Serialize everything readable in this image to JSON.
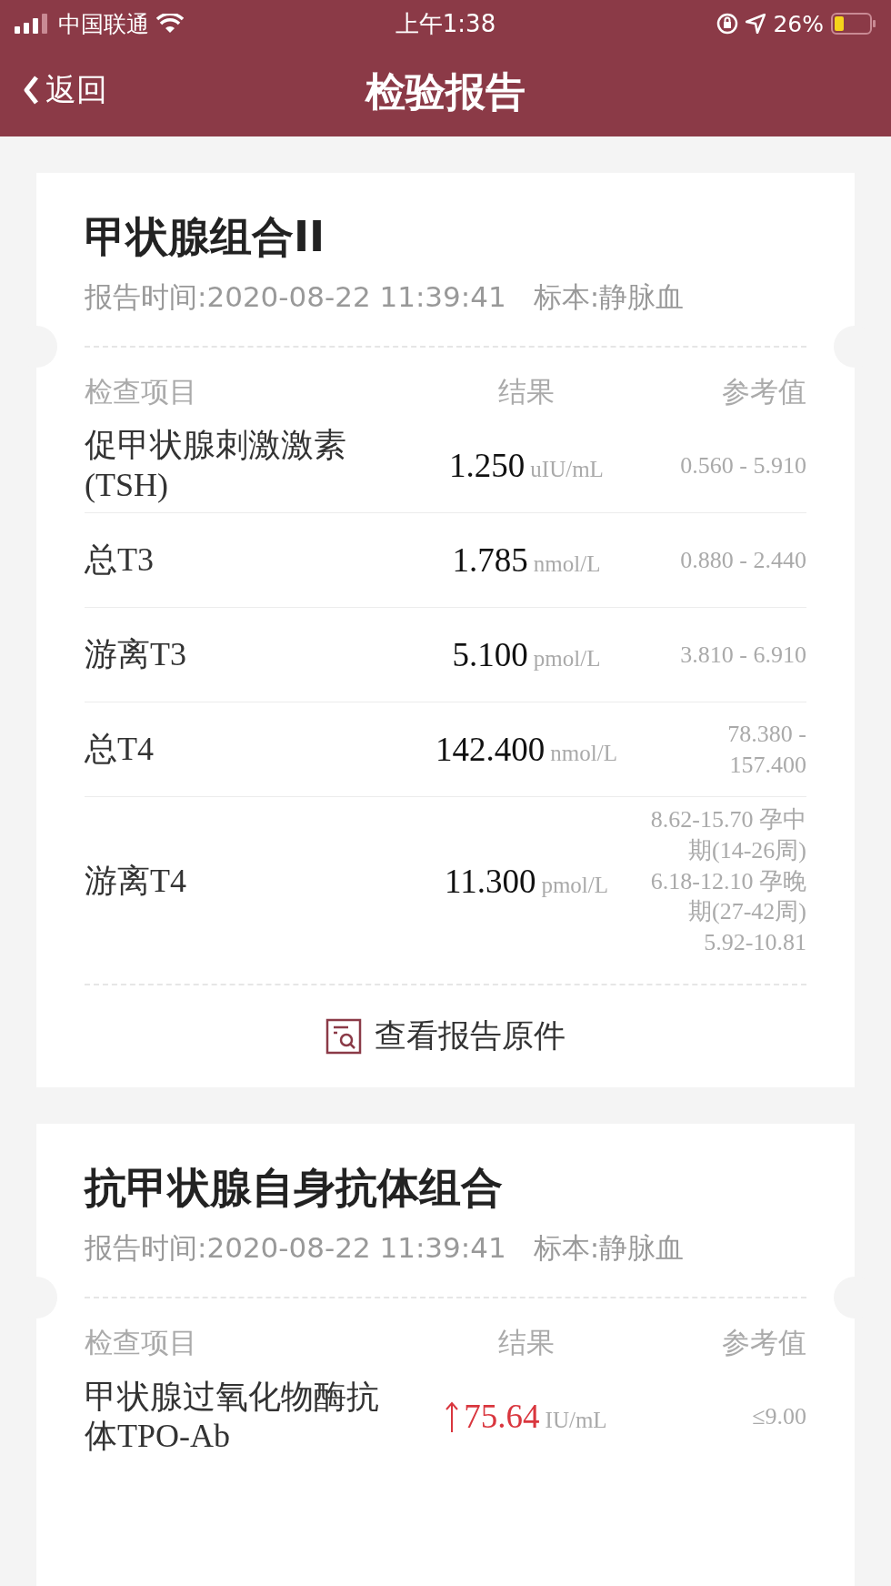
{
  "status_bar": {
    "carrier": "中国联通",
    "time": "上午1:38",
    "battery": "26%"
  },
  "nav": {
    "back": "返回",
    "title": "检验报告"
  },
  "reports": [
    {
      "title": "甲状腺组合II",
      "report_time": "报告时间:2020-08-22 11:39:41",
      "specimen": "标本:静脉血",
      "columns": [
        "检查项目",
        "结果",
        "参考值"
      ],
      "items": [
        {
          "name": "促甲状腺刺激激素(TSH)",
          "value": "1.250",
          "unit": "uIU/mL",
          "reference": "0.560 - 5.910",
          "high": false
        },
        {
          "name": "总T3",
          "value": "1.785",
          "unit": "nmol/L",
          "reference": "0.880 - 2.440",
          "high": false
        },
        {
          "name": "游离T3",
          "value": "5.100",
          "unit": "pmol/L",
          "reference": "3.810 - 6.910",
          "high": false
        },
        {
          "name": "总T4",
          "value": "142.400",
          "unit": "nmol/L",
          "reference": "78.380 - 157.400",
          "high": false
        },
        {
          "name": "游离T4",
          "value": "11.300",
          "unit": "pmol/L",
          "reference": "8.62-15.70 孕中期(14-26周) 6.18-12.10 孕晚期(27-42周) 5.92-10.81",
          "high": false
        }
      ],
      "action": "查看报告原件"
    },
    {
      "title": "抗甲状腺自身抗体组合",
      "report_time": "报告时间:2020-08-22 11:39:41",
      "specimen": "标本:静脉血",
      "columns": [
        "检查项目",
        "结果",
        "参考值"
      ],
      "items": [
        {
          "name": "甲状腺过氧化物酶抗体TPO-Ab",
          "value": "75.64",
          "unit": "IU/mL",
          "reference": "≤9.00",
          "high": true
        }
      ]
    }
  ]
}
